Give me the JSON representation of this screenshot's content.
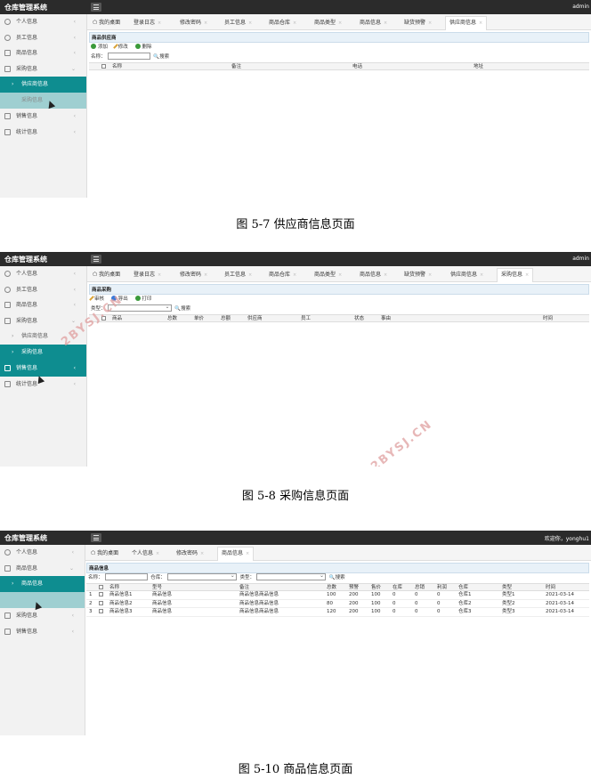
{
  "shots": [
    {
      "app_title": "仓库管理系统",
      "user": "admin",
      "sidebar": {
        "items": [
          {
            "label": "个人信息",
            "chevron": "‹"
          },
          {
            "label": "员工信息",
            "chevron": "‹"
          },
          {
            "label": "商品信息",
            "chevron": "‹"
          },
          {
            "label": "采购信息",
            "chevron": "⌄"
          },
          {
            "label": "供应商信息"
          },
          {
            "label": "采购信息"
          },
          {
            "label": "销售信息",
            "chevron": "‹"
          },
          {
            "label": "统计信息",
            "chevron": "‹"
          }
        ]
      },
      "tabs": [
        {
          "label": "我的桌面"
        },
        {
          "label": "登录日志"
        },
        {
          "label": "修改密码"
        },
        {
          "label": "员工信息"
        },
        {
          "label": "商品仓库"
        },
        {
          "label": "商品类型"
        },
        {
          "label": "商品信息"
        },
        {
          "label": "缺货预警"
        },
        {
          "label": "供应商信息"
        }
      ],
      "panel_title": "商品供应商",
      "toolbar": {
        "add": "添加",
        "edit": "修改",
        "delete": "删除"
      },
      "search": {
        "name_label": "名称：",
        "search_label": "搜索"
      },
      "table_headers": [
        "名称",
        "备注",
        "电话",
        "地址"
      ],
      "caption": "图 5-7 供应商信息页面"
    },
    {
      "app_title": "仓库管理系统",
      "user": "admin",
      "sidebar": {
        "items": [
          {
            "label": "个人信息",
            "chevron": "‹"
          },
          {
            "label": "员工信息",
            "chevron": "‹"
          },
          {
            "label": "商品信息",
            "chevron": "‹"
          },
          {
            "label": "采购信息",
            "chevron": "⌄"
          },
          {
            "label": "供应商信息"
          },
          {
            "label": "采购信息"
          },
          {
            "label": "销售信息",
            "chevron": "‹"
          },
          {
            "label": "统计信息",
            "chevron": "‹"
          }
        ]
      },
      "tabs": [
        {
          "label": "我的桌面"
        },
        {
          "label": "登录日志"
        },
        {
          "label": "修改密码"
        },
        {
          "label": "员工信息"
        },
        {
          "label": "商品仓库"
        },
        {
          "label": "商品类型"
        },
        {
          "label": "商品信息"
        },
        {
          "label": "缺货预警"
        },
        {
          "label": "供应商信息"
        },
        {
          "label": "采购信息"
        }
      ],
      "panel_title": "商品采购",
      "toolbar": {
        "review": "审核",
        "export": "导出",
        "print": "打印"
      },
      "search": {
        "type_label": "类型：",
        "search_label": "搜索"
      },
      "table_headers": [
        "商品",
        "总数",
        "单价",
        "总额",
        "供应商",
        "员工",
        "状态",
        "事由",
        "时间"
      ],
      "watermark": "2BYSJ.CN",
      "caption": "图 5-8 采购信息页面"
    },
    {
      "app_title": "仓库管理系统",
      "user": "欢迎你，yonghu1",
      "sidebar": {
        "items": [
          {
            "label": "个人信息",
            "chevron": "‹"
          },
          {
            "label": "商品信息",
            "chevron": "⌄"
          },
          {
            "label": "商品信息"
          },
          {
            "label": "采购信息",
            "chevron": "‹"
          },
          {
            "label": "销售信息",
            "chevron": "‹"
          }
        ]
      },
      "tabs": [
        {
          "label": "我的桌面"
        },
        {
          "label": "个人信息"
        },
        {
          "label": "修改密码"
        },
        {
          "label": "商品信息"
        }
      ],
      "panel_title": "商品信息",
      "search": {
        "name_label": "名称：",
        "warehouse_label": "仓库：",
        "type_label": "类型：",
        "search_label": "搜索"
      },
      "table_headers": [
        "名称",
        "型号",
        "备注",
        "总数",
        "预警",
        "售价",
        "在库",
        "总销",
        "利润",
        "仓库",
        "类型",
        "时间"
      ],
      "rows": [
        [
          "1",
          "商品信息1",
          "商品信息",
          "商品信息商品信息",
          "100",
          "200",
          "100",
          "0",
          "0",
          "0",
          "仓库1",
          "类型1",
          "2021-03-14"
        ],
        [
          "2",
          "商品信息2",
          "商品信息",
          "商品信息商品信息",
          "80",
          "200",
          "100",
          "0",
          "0",
          "0",
          "仓库2",
          "类型2",
          "2021-03-14"
        ],
        [
          "3",
          "商品信息3",
          "商品信息",
          "商品信息商品信息",
          "120",
          "200",
          "100",
          "0",
          "0",
          "0",
          "仓库3",
          "类型3",
          "2021-03-14"
        ]
      ],
      "caption": "图 5-10 商品信息页面"
    }
  ],
  "colors": {
    "topbar": "#2b2b2b",
    "accent": "#0e8d90",
    "watermark": "#e0a0a0"
  }
}
